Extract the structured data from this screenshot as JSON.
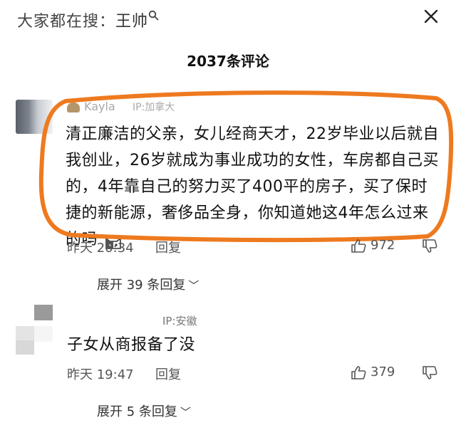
{
  "header": {
    "search_prefix": "大家都在搜：",
    "search_keyword": "王帅",
    "close_icon": "close-icon"
  },
  "comment_count": "2037条评论",
  "comments": [
    {
      "username": "Kayla",
      "ip": "IP:加拿大",
      "text": "清正廉洁的父亲，女儿经商天才，22岁毕业以后就自我创业，26岁就成为事业成功的女性，车房都自己买的，4年靠自己的努力买了400平的房子，买了保时捷的新能源，奢侈品全身，你知道她这4年怎么过来的吗",
      "emoji": "cat-emoji-icon",
      "time": "昨天 20:34",
      "reply_label": "回复",
      "likes": "972",
      "expand_label": "展开 39 条回复",
      "highlight_color": "#ee7a1f"
    },
    {
      "username": "",
      "ip": "IP:安徽",
      "text": "子女从商报备了没",
      "time": "昨天 19:47",
      "reply_label": "回复",
      "likes": "379",
      "expand_label": "展开 5 条回复"
    }
  ]
}
